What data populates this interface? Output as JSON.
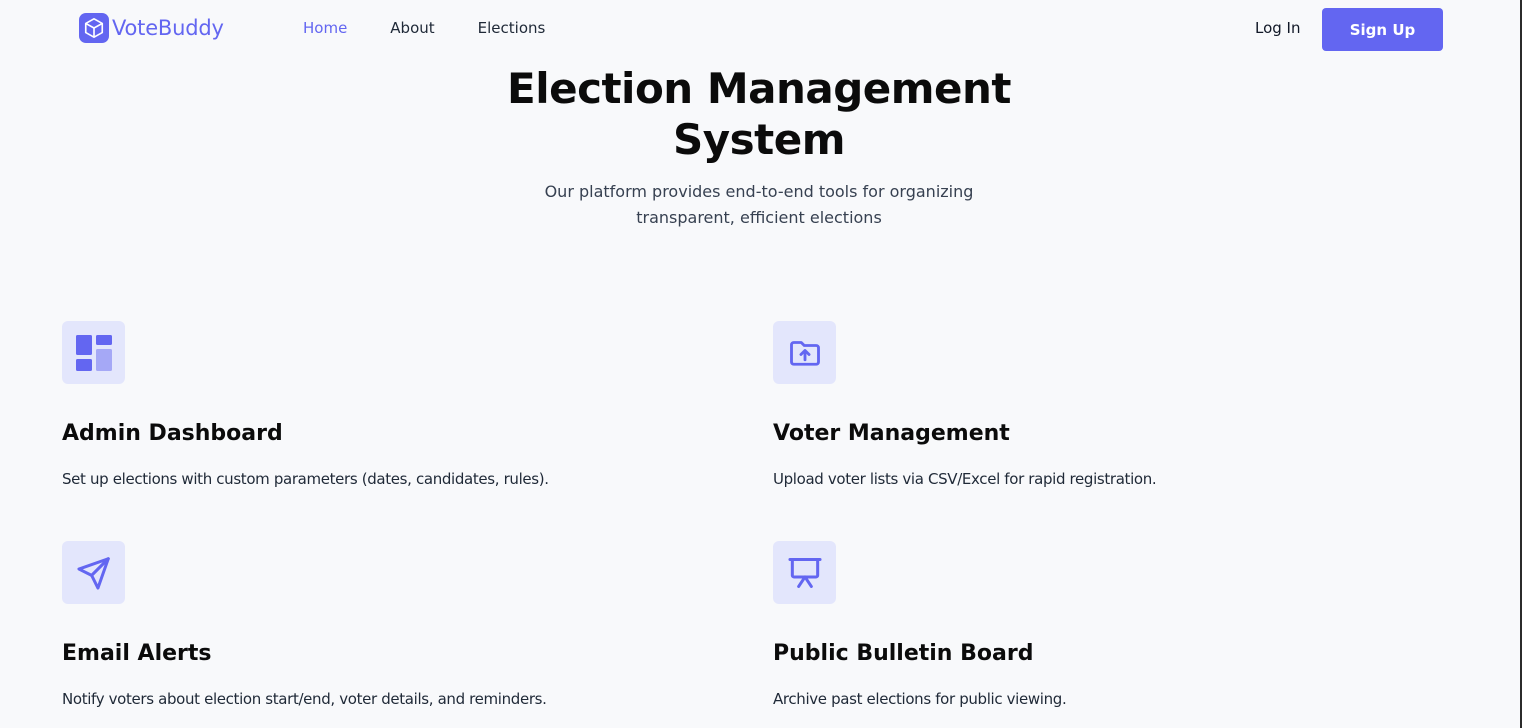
{
  "brand": {
    "name": "VoteBuddy",
    "accent_color": "#6366f1",
    "logo_icon": "cube-icon"
  },
  "nav": {
    "links": [
      "Home",
      "About",
      "Elections"
    ],
    "active": "Home",
    "login_label": "Log In",
    "signup_label": "Sign Up"
  },
  "hero": {
    "title_line1": "Election Management",
    "title_line2": "System",
    "subtitle_line1": "Our platform provides end-to-end tools for organizing",
    "subtitle_line2": "transparent, efficient elections"
  },
  "features": [
    {
      "icon": "dashboard-icon",
      "title": "Admin Dashboard",
      "description": "Set up elections with custom parameters (dates, candidates, rules)."
    },
    {
      "icon": "folder-upload-icon",
      "title": "Voter Management",
      "description": "Upload voter lists via CSV/Excel for rapid registration."
    },
    {
      "icon": "paper-plane-icon",
      "title": "Email Alerts",
      "description": "Notify voters about election start/end, voter details, and reminders."
    },
    {
      "icon": "presentation-board-icon",
      "title": "Public Bulletin Board",
      "description": "Archive past elections for public viewing."
    }
  ]
}
